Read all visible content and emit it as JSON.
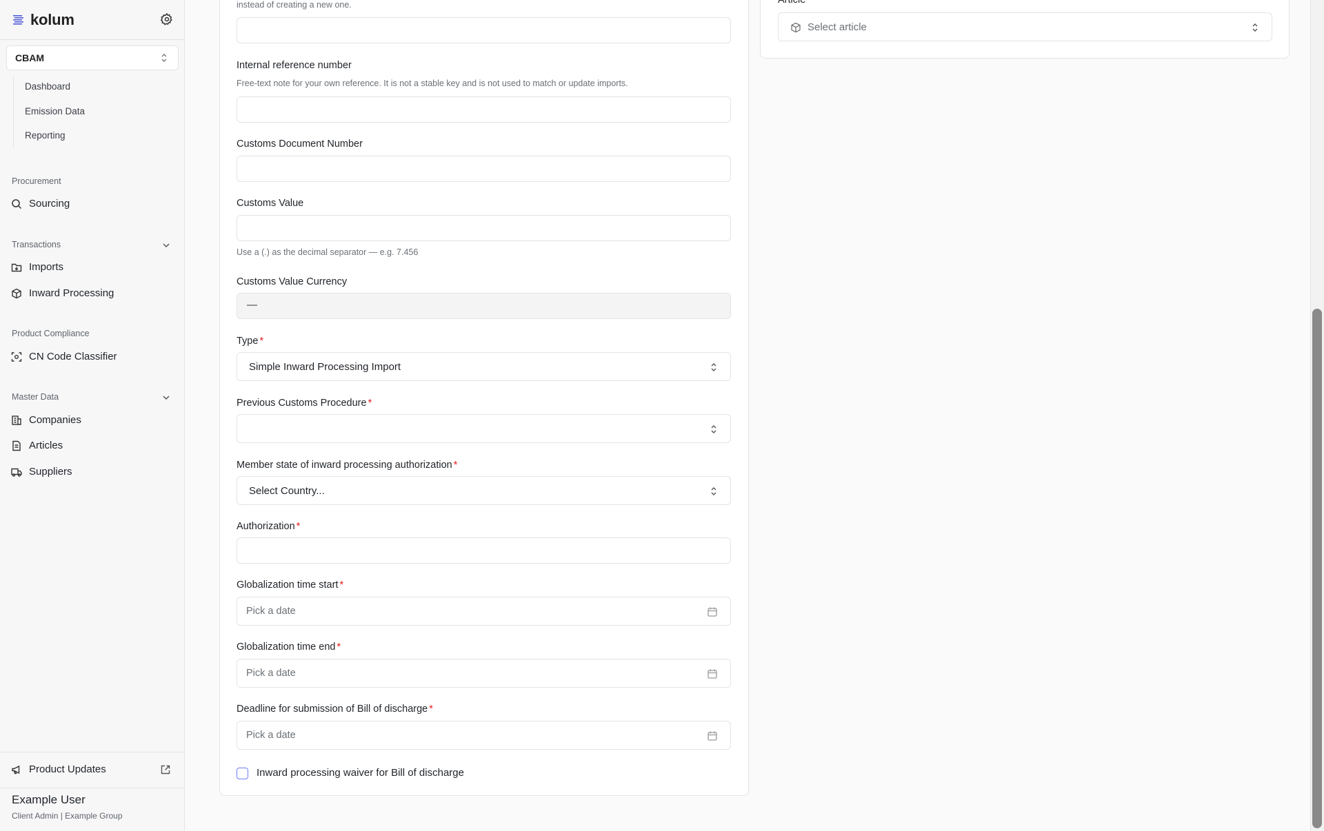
{
  "brand": {
    "name": "kolum"
  },
  "sidebar": {
    "module": "CBAM",
    "cbam_items": [
      "Dashboard",
      "Emission Data",
      "Reporting"
    ],
    "procurement": {
      "label": "Procurement",
      "items": [
        "Sourcing"
      ]
    },
    "transactions": {
      "label": "Transactions",
      "items": [
        "Imports",
        "Inward Processing"
      ]
    },
    "product_compliance": {
      "label": "Product Compliance",
      "items": [
        "CN Code Classifier"
      ]
    },
    "master_data": {
      "label": "Master Data",
      "items": [
        "Companies",
        "Articles",
        "Suppliers"
      ]
    },
    "product_updates": "Product Updates",
    "user": {
      "name": "Example User",
      "role": "Client Admin | Example Group"
    }
  },
  "form": {
    "top_hint": "instead of creating a new one.",
    "internal_ref": {
      "label": "Internal reference number",
      "hint": "Free-text note for your own reference. It is not a stable key and is not used to match or update imports."
    },
    "customs_doc": {
      "label": "Customs Document Number"
    },
    "customs_value": {
      "label": "Customs Value",
      "hint": "Use a (.) as the decimal separator — e.g. 7.456"
    },
    "customs_currency": {
      "label": "Customs Value Currency",
      "value": "—"
    },
    "type": {
      "label": "Type",
      "value": "Simple Inward Processing Import"
    },
    "prev_procedure": {
      "label": "Previous Customs Procedure",
      "value": ""
    },
    "member_state": {
      "label": "Member state of inward processing authorization",
      "value": "Select Country..."
    },
    "authorization": {
      "label": "Authorization"
    },
    "glob_start": {
      "label": "Globalization time start",
      "placeholder": "Pick a date"
    },
    "glob_end": {
      "label": "Globalization time end",
      "placeholder": "Pick a date"
    },
    "deadline": {
      "label": "Deadline for submission of Bill of discharge",
      "placeholder": "Pick a date"
    },
    "required_mark": "*",
    "waiver": {
      "label": "Inward processing waiver for Bill of discharge",
      "checked": false
    }
  },
  "article_panel": {
    "label": "Article",
    "placeholder": "Select article"
  }
}
